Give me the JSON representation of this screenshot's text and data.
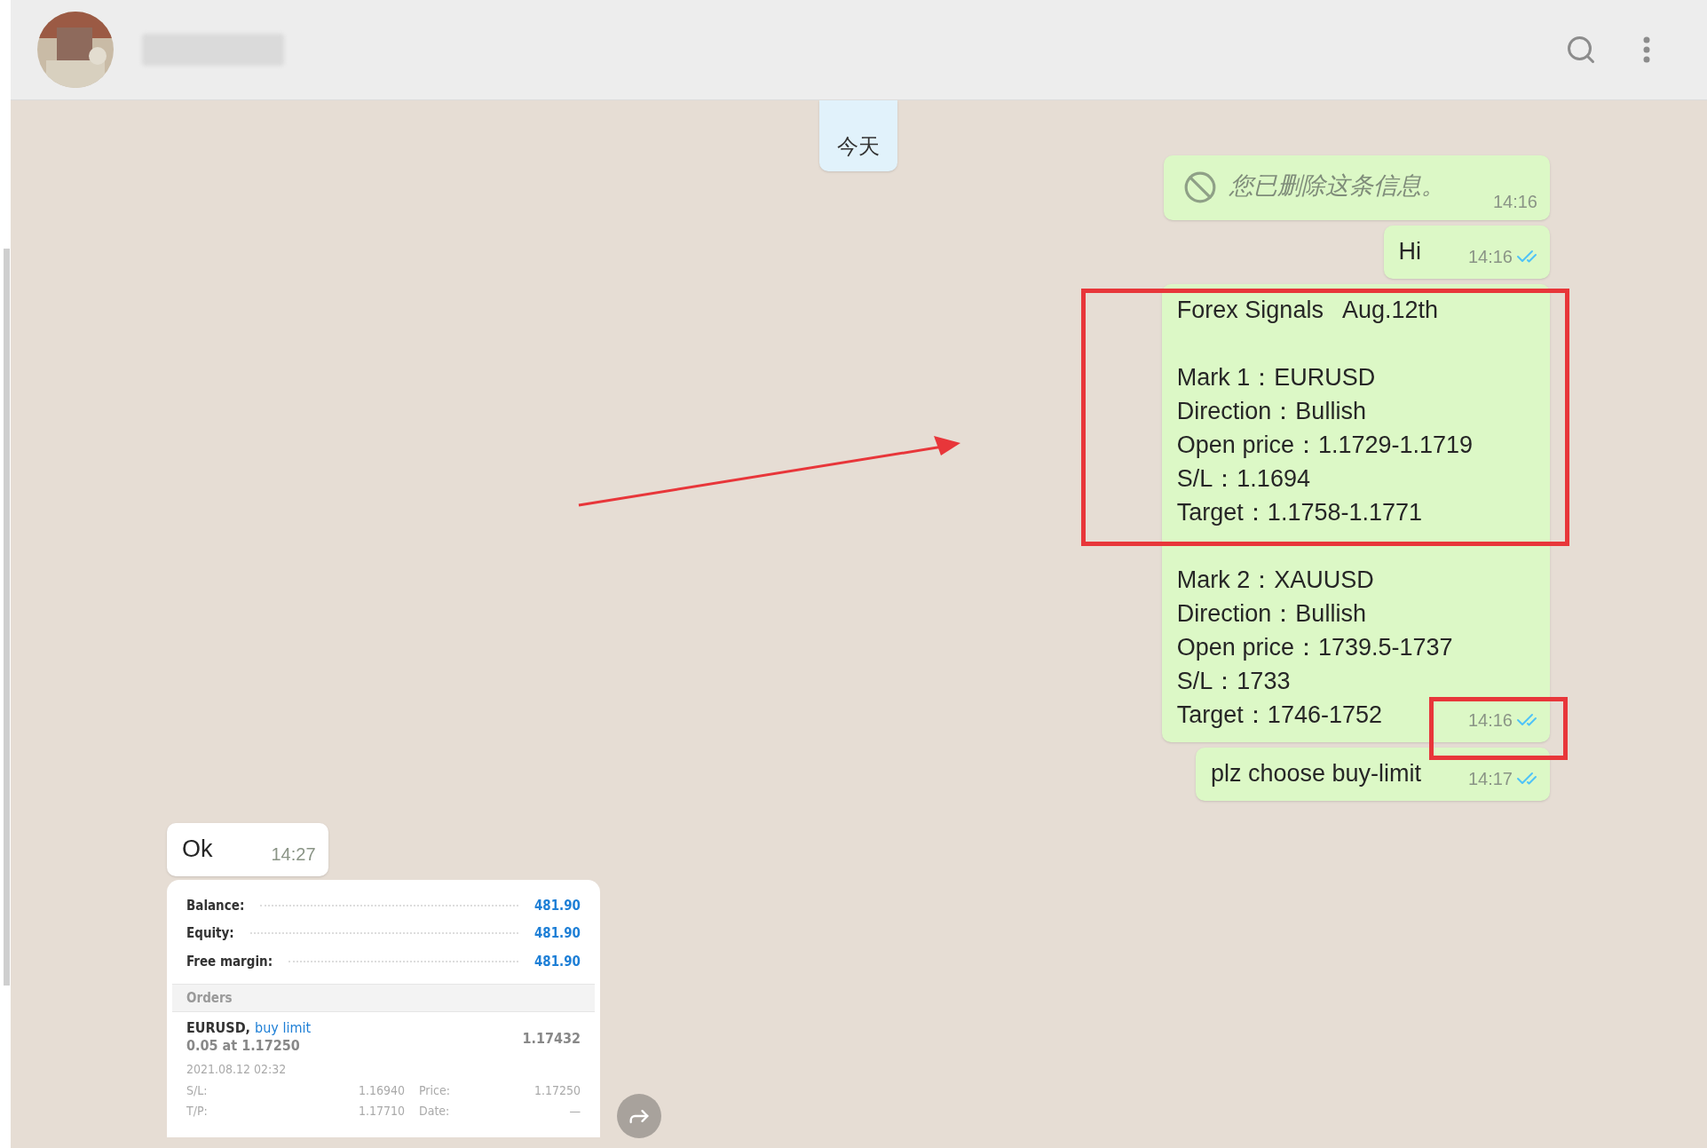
{
  "date_chip": "今天",
  "messages": [
    {
      "kind": "deleted",
      "outgoing": true,
      "text": "您已删除这条信息。",
      "time": "14:16"
    },
    {
      "kind": "text",
      "outgoing": true,
      "paragraphs": [
        [
          "Hi"
        ]
      ],
      "time": "14:16",
      "read": true
    },
    {
      "kind": "text",
      "outgoing": true,
      "paragraphs": [
        [
          "Forex Signals   Aug.12th"
        ],
        [
          "Mark 1：EURUSD",
          "Direction：Bullish",
          "Open price：1.1729-1.1719",
          "S/L：1.1694",
          "Target：1.1758-1.1771"
        ],
        [
          "Mark 2：XAUUSD",
          "Direction：Bullish",
          "Open price：1739.5-1737",
          "S/L：1733",
          "Target：1746-1752"
        ]
      ],
      "time": "14:16",
      "read": true
    },
    {
      "kind": "text",
      "outgoing": true,
      "paragraphs": [
        [
          "plz choose buy-limit"
        ]
      ],
      "time": "14:17",
      "read": true
    },
    {
      "kind": "text",
      "outgoing": false,
      "paragraphs": [
        [
          "Ok"
        ]
      ],
      "time": "14:27"
    },
    {
      "kind": "screenshot",
      "outgoing": false,
      "account": [
        {
          "label": "Balance:",
          "value": "481.90"
        },
        {
          "label": "Equity:",
          "value": "481.90"
        },
        {
          "label": "Free margin:",
          "value": "481.90"
        }
      ],
      "section": "Orders",
      "order": {
        "symbol": "EURUSD,",
        "type": "buy limit",
        "volume": "0.05 at 1.17250",
        "current": "1.17432",
        "date": "2021.08.12 02:32",
        "fields": [
          [
            "S/L:",
            "1.16940",
            "Price:",
            "1.17250"
          ],
          [
            "T/P:",
            "1.17710",
            "Date:",
            "—"
          ]
        ]
      }
    }
  ]
}
